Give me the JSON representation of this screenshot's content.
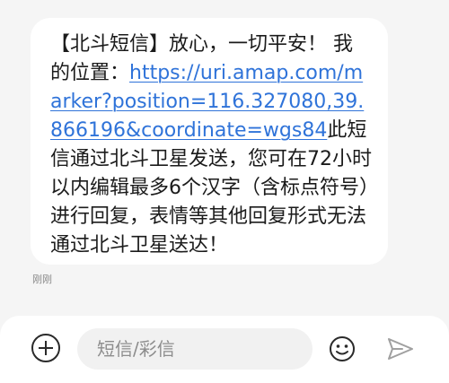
{
  "message": {
    "text_before_link": "【北斗短信】放心，一切平安！ 我的位置：",
    "link": "https://uri.amap.com/marker?position=116.327080,39.866196&coordinate=wgs84",
    "text_after_link": "此短信通过北斗卫星发送，您可在72小时以内编辑最多6个汉字（含标点符号）进行回复，表情等其他回复形式无法通过北斗卫星送达！",
    "timestamp": "刚刚"
  },
  "composer": {
    "placeholder": "短信/彩信",
    "add_icon": "plus-circle-icon",
    "emoji_icon": "smiley-icon",
    "send_icon": "send-arrow-icon"
  },
  "colors": {
    "background": "#f5f5f5",
    "bubble": "#ffffff",
    "link": "#2f73d9",
    "icon": "#2a2a2a",
    "send_disabled": "#a0a0a0"
  }
}
